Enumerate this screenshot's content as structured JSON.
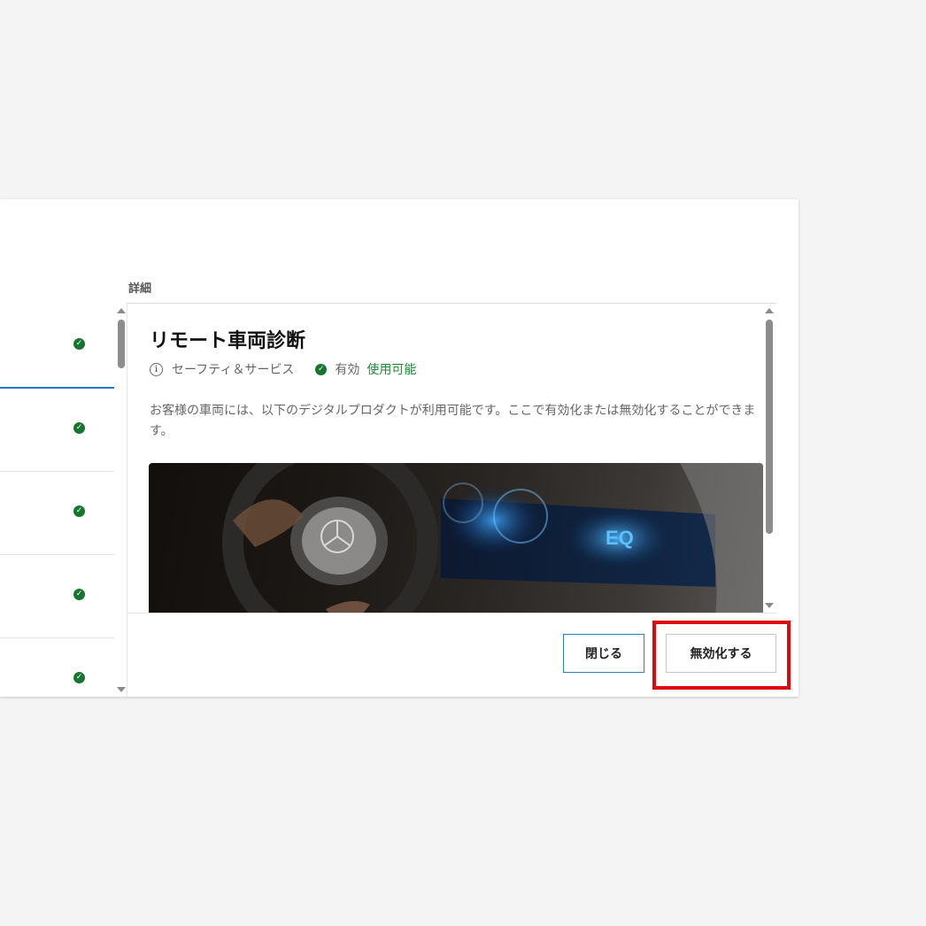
{
  "details_header": "詳細",
  "list": {
    "items": [
      {
        "status": "active"
      },
      {
        "status": "active"
      },
      {
        "status": "active"
      },
      {
        "status": "active"
      },
      {
        "status": "active"
      }
    ]
  },
  "product": {
    "title": "リモート車両診断",
    "category": "セーフティ＆サービス",
    "status_label": "有効",
    "availability": "使用可能",
    "description": "お客様の車両には、以下のデジタルプロダクトが利用可能です。ここで有効化または無効化することができます。",
    "display_text": "EQ"
  },
  "buttons": {
    "close_label": "閉じる",
    "disable_label": "無効化する"
  },
  "icons": {
    "info": "info-icon",
    "check": "check-circle-icon"
  },
  "colors": {
    "accent": "#1f7ac6",
    "success": "#16752f",
    "highlight": "#e0070c"
  }
}
